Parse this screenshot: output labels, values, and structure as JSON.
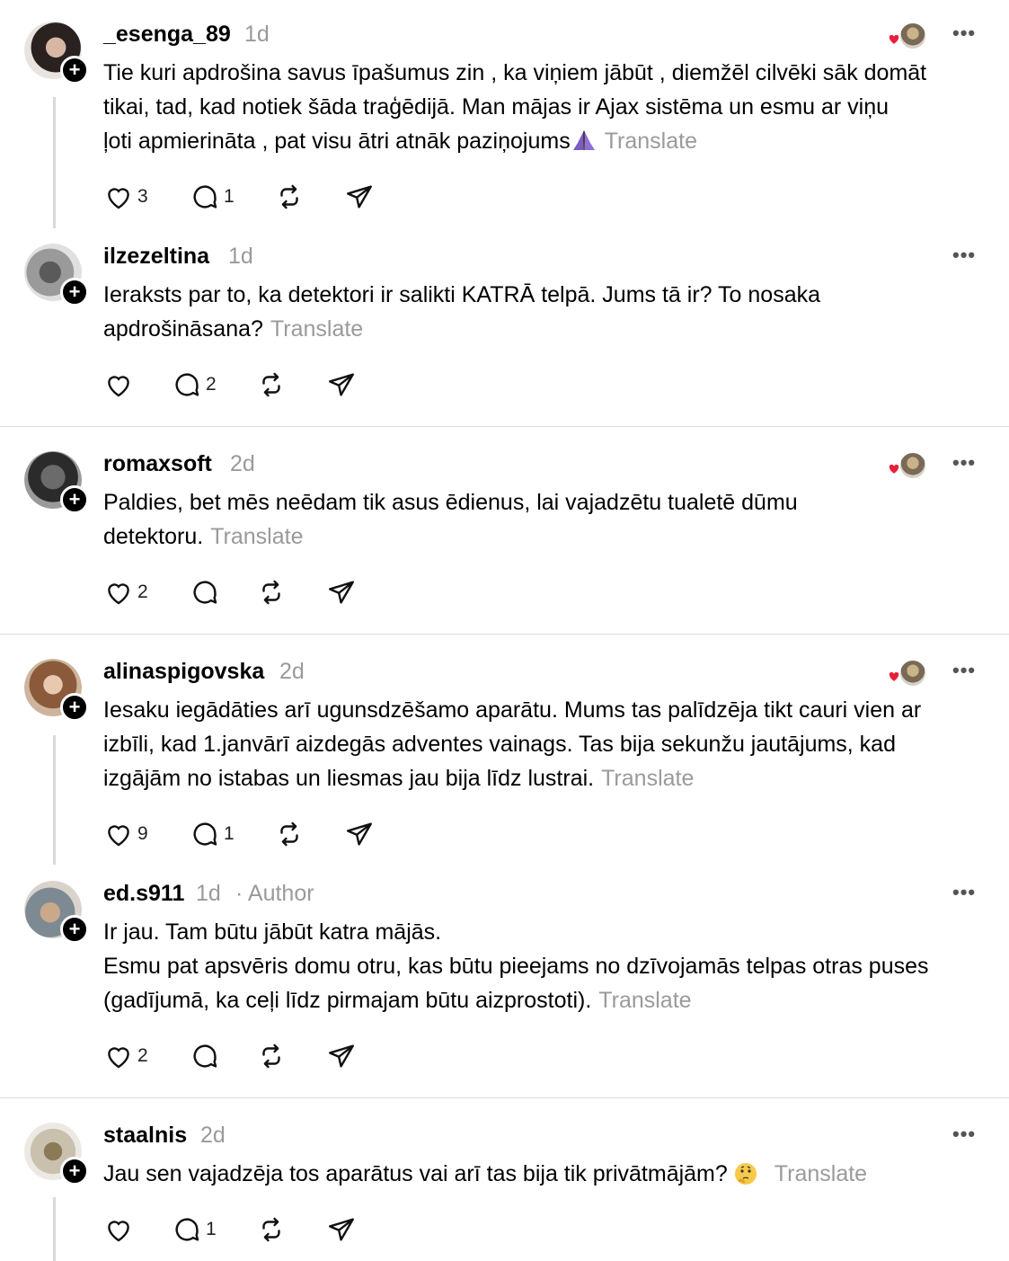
{
  "posts": [
    {
      "user": "_esenga_89",
      "time": "1d",
      "author": "",
      "lines": [
        "Tie kuri apdrošina savus īpašumus zin , ka viņiem jābūt , diemžēl cilvēki sāk domāt",
        "tikai, tad, kad notiek šāda traģēdijā. Man mājas ir Ajax sistēma un esmu ar viņu",
        "ļoti apmierināta , pat visu ātri atnāk paziņojums"
      ],
      "translate": "Translate",
      "likes": "3",
      "replies": "1",
      "liked_by_author": true
    },
    {
      "user": "ilzezeltina",
      "time": "1d",
      "author": "",
      "lines": [
        "Ieraksts par to, ka detektori ir salikti KATRĀ telpā. Jums tā ir? To nosaka",
        "apdrošināsana?"
      ],
      "translate": "Translate",
      "likes": "",
      "replies": "2",
      "liked_by_author": false
    },
    {
      "user": "romaxsoft",
      "time": "2d",
      "author": "",
      "lines": [
        "Paldies, bet mēs neēdam tik asus ēdienus, lai vajadzētu tualetē dūmu",
        "detektoru."
      ],
      "translate": "Translate",
      "likes": "2",
      "replies": "",
      "liked_by_author": true
    },
    {
      "user": "alinaspigovska",
      "time": "2d",
      "author": "",
      "lines": [
        "Iesaku iegādāties arī ugunsdzēšamo aparātu. Mums tas palīdzēja tikt cauri vien ar",
        "izbīli, kad 1.janvārī aizdegās adventes vainags. Tas bija sekunžu jautājums, kad",
        "izgājām no istabas un liesmas jau bija līdz lustrai."
      ],
      "translate": "Translate",
      "likes": "9",
      "replies": "1",
      "liked_by_author": true
    },
    {
      "user": "ed.s911",
      "time": "1d",
      "author": "· Author",
      "lines": [
        "Ir jau. Tam būtu jābūt katra mājās.",
        "Esmu pat apsvēris domu otru, kas būtu pieejams no dzīvojamās telpas otras puses",
        "(gadījumā, ka ceļi līdz pirmajam būtu aizprostoti)."
      ],
      "translate": "Translate",
      "likes": "2",
      "replies": "",
      "liked_by_author": false
    },
    {
      "user": "staalnis",
      "time": "2d",
      "author": "",
      "lines": [
        "Jau sen vajadzēja tos aparātus vai arī tas bija tik privātmājām?"
      ],
      "translate": "Translate",
      "likes": "",
      "replies": "1",
      "liked_by_author": false
    }
  ],
  "colors": {
    "heart_red": "#e8203a",
    "muted": "#9a9a9a",
    "divider": "#dcdcdc"
  },
  "icons": [
    "heart-icon",
    "comment-icon",
    "repost-icon",
    "share-icon",
    "more-icon",
    "follow-plus-icon"
  ]
}
